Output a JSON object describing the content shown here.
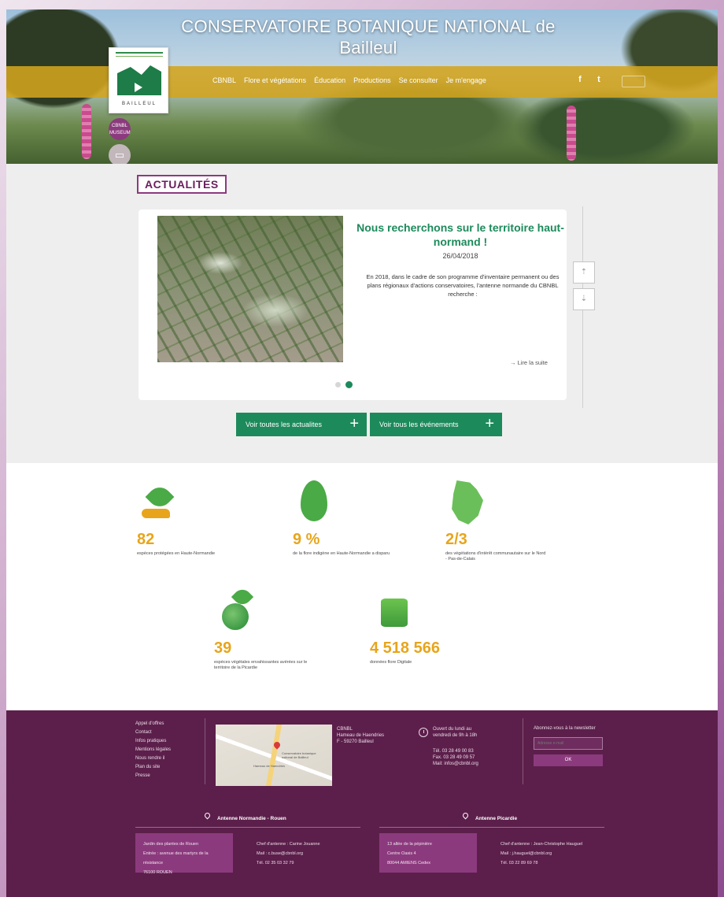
{
  "header": {
    "site_title_line1": "CONSERVATOIRE BOTANIQUE NATIONAL de",
    "site_title_line2": "Bailleul",
    "nav": [
      "CBNBL",
      "Flore et végétations",
      "Éducation",
      "Productions",
      "Se consulter",
      "Je m'engage"
    ],
    "social": [
      "f",
      "t"
    ],
    "logo_text": "BAILLEUL",
    "badge": "CBNBL MUSEUM"
  },
  "news": {
    "section_title": "ACTUALITÉS",
    "article": {
      "title": "Nous recherchons sur le territoire haut-normand !",
      "date": "26/04/2018",
      "excerpt": "En 2018, dans le cadre de son programme d'inventaire permanent ou des plans régionaux d'actions conservatoires, l'antenne normande du CBNBL recherche :",
      "read_more": "→ Lire la suite"
    },
    "buttons": {
      "all_news": "Voir toutes les actualites",
      "all_events": "Voir tous les événements"
    }
  },
  "stats": [
    {
      "value": "82",
      "caption": "espèces protégées en Haute-Normandie"
    },
    {
      "value": "9 %",
      "caption": "de la flore indigène en Haute-Normandie a disparu"
    },
    {
      "value": "2/3",
      "caption": "des végétations d'intérêt communautaire sur le Nord - Pas-de-Calais"
    },
    {
      "value": "39",
      "caption": "espèces végétales envahissantes avérées sur le territoire de la Picardie"
    },
    {
      "value": "4 518 566",
      "caption": "données flore Digitale"
    }
  ],
  "footer": {
    "links": [
      "Appel d'offres",
      "Contact",
      "Infos pratiques",
      "Mentions légales",
      "Nous rendre il",
      "Plan du site",
      "Presse"
    ],
    "address": [
      "CBNBL",
      "Hameau de Haendries",
      "F - 59270 Bailleul"
    ],
    "hours": [
      "Ouvert du lundi au",
      "vendredi de 9h à 18h"
    ],
    "contact": [
      "Tél. 03 28 49 00 83",
      "Fax. 03 28 49 09 57",
      "Mail: infos@cbnbl.org"
    ],
    "newsletter_label": "Abonnez-vous à la newsletter",
    "newsletter_placeholder": "Adresse e-mail",
    "newsletter_button": "OK",
    "map_labels": [
      "Conservatoire botanique national de Bailleul",
      "Hameau de Haendries"
    ],
    "antennes": [
      {
        "title": "Antenne Normandie - Rouen",
        "box": [
          "Jardin des plantes de Rouen",
          "Entrée : avenue des martyrs de la résistance",
          "76100 ROUEN"
        ],
        "info": [
          "Chef d'antenne : Carine Jouanne",
          "Mail : c.buse@cbnbl.org",
          "Tél. 02 35 03 32 79"
        ]
      },
      {
        "title": "Antenne Picardie",
        "box": [
          "13 allée de la pépinière",
          "Centre Oasis 4",
          "80044 AMIENS Cedex"
        ],
        "info": [
          "Chef d'antenne : Jean-Christophe Hauguel",
          "Mail : j.hauguel@cbnbl.org",
          "Tél. 03 22 89 69 78"
        ]
      }
    ]
  },
  "colors": {
    "accent_purple": "#8c3a7e",
    "footer_purple": "#5c1f4b",
    "green": "#1d8a5b",
    "stat_orange": "#e8a51b",
    "nav_gold": "#d3a41e"
  },
  "carousel": {
    "slide_count": 2,
    "active_slide": 2
  }
}
